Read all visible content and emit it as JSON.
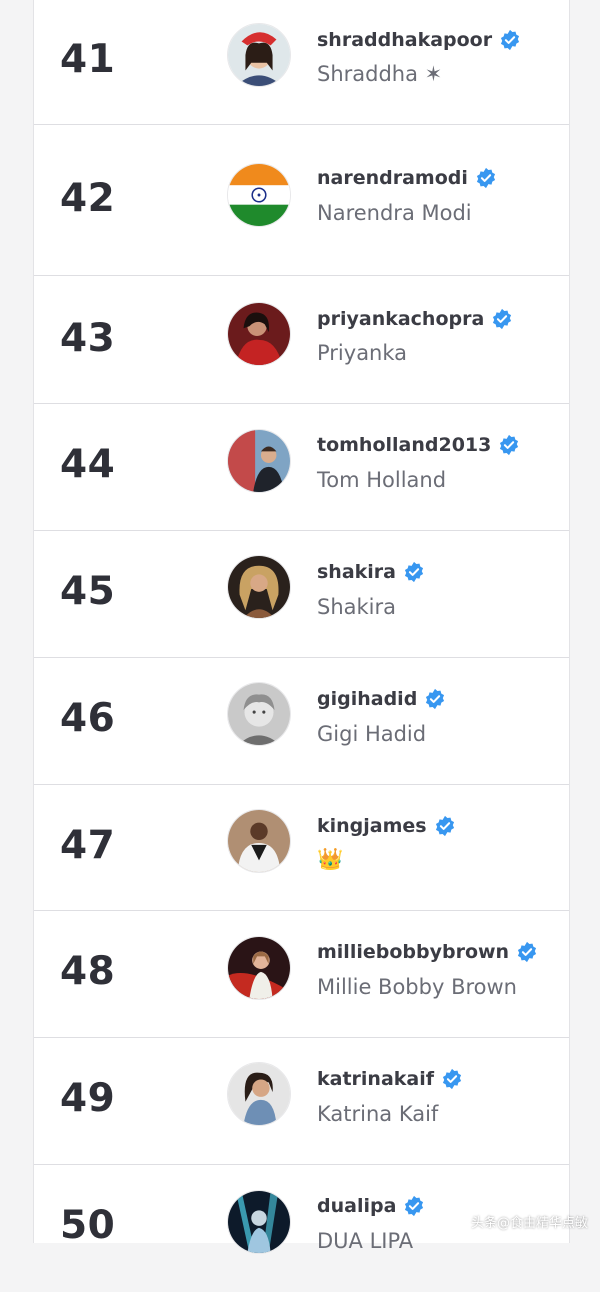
{
  "rows": [
    {
      "rank": "41",
      "handle": "shraddhakapoor",
      "name": "Shraddha ✶",
      "avatar": "portrait-santa-hat"
    },
    {
      "rank": "42",
      "handle": "narendramodi",
      "name": "Narendra Modi",
      "avatar": "india-flag"
    },
    {
      "rank": "43",
      "handle": "priyankachopra",
      "name": "Priyanka",
      "avatar": "portrait-red-dress"
    },
    {
      "rank": "44",
      "handle": "tomholland2013",
      "name": "Tom Holland",
      "avatar": "portrait-outdoor"
    },
    {
      "rank": "45",
      "handle": "shakira",
      "name": "Shakira",
      "avatar": "portrait-blonde"
    },
    {
      "rank": "46",
      "handle": "gigihadid",
      "name": "Gigi Hadid",
      "avatar": "portrait-bw-child"
    },
    {
      "rank": "47",
      "handle": "kingjames",
      "name": "👑",
      "avatar": "portrait-jersey"
    },
    {
      "rank": "48",
      "handle": "milliebobbybrown",
      "name": "Millie Bobby Brown",
      "avatar": "portrait-red-light"
    },
    {
      "rank": "49",
      "handle": "katrinakaif",
      "name": "Katrina Kaif",
      "avatar": "portrait-denim"
    },
    {
      "rank": "50",
      "handle": "dualipa",
      "name": "DUA LIPA",
      "avatar": "portrait-stage-blue"
    }
  ],
  "badge_icon": "verified-badge-icon",
  "colors": {
    "badge": "#3897f0",
    "rank_text": "#2f3038",
    "handle_text": "#3b3c44",
    "name_text": "#6b6d76"
  },
  "watermark": "头条@食由精华点敏"
}
